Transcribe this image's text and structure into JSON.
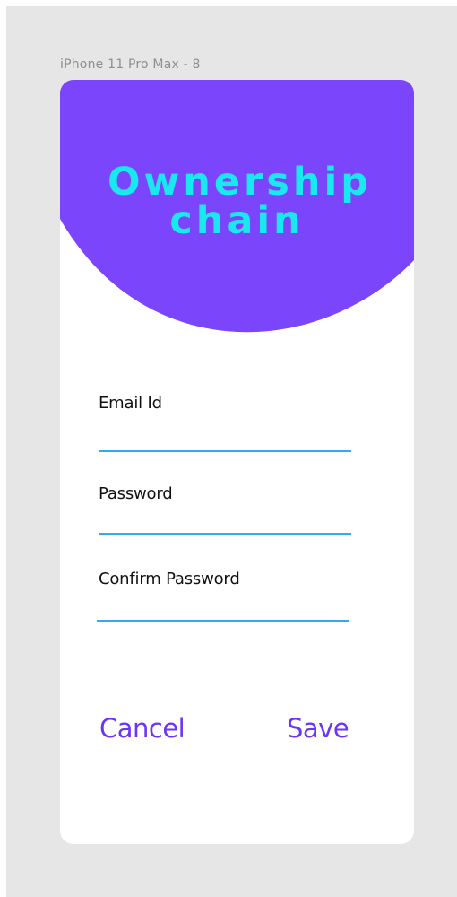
{
  "artboard": {
    "label": "iPhone 11 Pro Max - 8"
  },
  "colors": {
    "canvas": "#e6e6e6",
    "header": "#7b45fb",
    "title": "#19e8f0",
    "underline": "#35a9ef",
    "button": "#6a35f5"
  },
  "header": {
    "title_line1": "Ownership",
    "title_line2": "chain"
  },
  "form": {
    "email_label": "Email Id",
    "email_value": "",
    "password_label": "Password",
    "password_value": "",
    "confirm_label": "Confirm Password",
    "confirm_value": ""
  },
  "actions": {
    "cancel_label": "Cancel",
    "save_label": "Save"
  }
}
